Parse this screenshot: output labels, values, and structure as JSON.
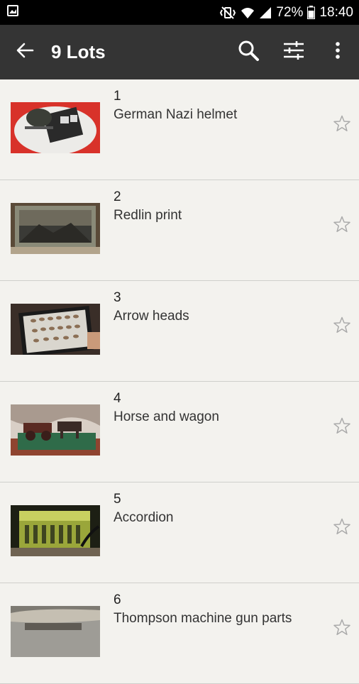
{
  "status_bar": {
    "battery_percent": "72%",
    "time": "18:40",
    "icons": [
      "image-notification-icon",
      "mute-vibrate-icon",
      "wifi-icon",
      "signal-icon",
      "battery-icon"
    ]
  },
  "app_bar": {
    "title": "9 Lots",
    "back_icon": "arrow-back-icon",
    "actions": [
      "search-icon",
      "filter-sliders-icon",
      "more-vert-icon"
    ]
  },
  "lots": [
    {
      "number": "1",
      "name": "German Nazi helmet"
    },
    {
      "number": "2",
      "name": "Redlin print"
    },
    {
      "number": "3",
      "name": "Arrow heads"
    },
    {
      "number": "4",
      "name": "Horse and wagon"
    },
    {
      "number": "5",
      "name": "Accordion"
    },
    {
      "number": "6",
      "name": "Thompson machine gun parts"
    }
  ],
  "colors": {
    "app_bar": "#343434",
    "status_bar": "#000000",
    "list_background": "#f3f2ee",
    "divider": "#cfcfcb",
    "star": "#aaaaaa"
  }
}
